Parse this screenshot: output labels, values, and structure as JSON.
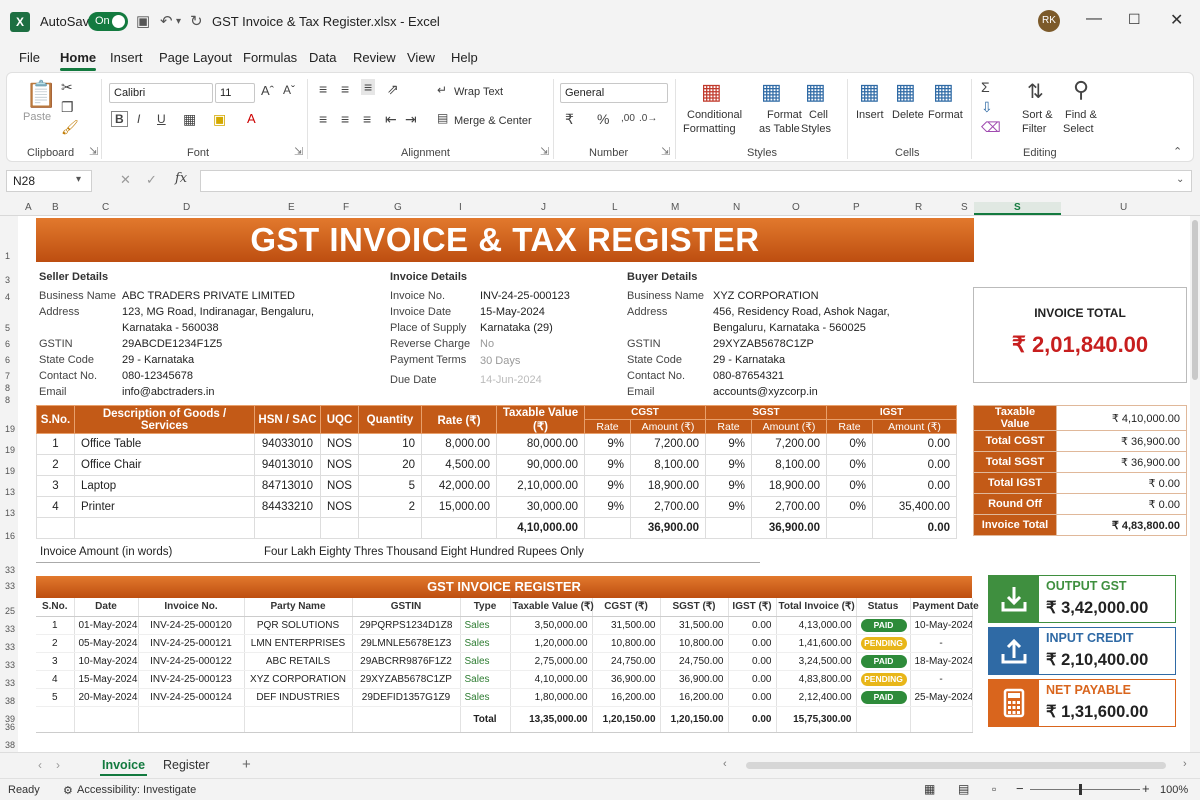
{
  "app": {
    "autosave_label": "AutoSave",
    "autosave_state": "On",
    "title": "GST Invoice & Tax Register.xlsx  -  Excel",
    "user_initials": "RK"
  },
  "menu": [
    "File",
    "Home",
    "Insert",
    "Page Layout",
    "Formulas",
    "Data",
    "Review",
    "View",
    "Help"
  ],
  "ribbon": {
    "paste": "Paste",
    "clipboard": "Clipboard",
    "font_name": "Calibri",
    "font_size": "11",
    "font": "Font",
    "wrap_text": "Wrap Text",
    "merge_center": "Merge & Center",
    "alignment": "Alignment",
    "number_format": "General",
    "number": "Number",
    "conditional_formatting": [
      "Conditional",
      "Formatting"
    ],
    "format_as_table": [
      "Format",
      "as Table"
    ],
    "cell_styles": [
      "Cell",
      "Styles"
    ],
    "styles": "Styles",
    "insert": "Insert",
    "delete": "Delete",
    "format": "Format",
    "cells": "Cells",
    "sort_filter": [
      "Sort &",
      "Filter"
    ],
    "find_select": [
      "Find &",
      "Select"
    ],
    "editing": "Editing"
  },
  "formula_bar": {
    "name_box": "N28",
    "formula": ""
  },
  "columns": [
    "A",
    "B",
    "C",
    "D",
    "E",
    "F",
    "G",
    "I",
    "J",
    "L",
    "M",
    "N",
    "O",
    "P",
    "R",
    "S",
    "S",
    "U"
  ],
  "rows": [
    "1",
    "3",
    "4",
    "5",
    "6",
    "6",
    "7",
    "8",
    "9",
    "8",
    "19",
    "19",
    "19",
    "13",
    "13",
    "16",
    "33",
    "33",
    "25",
    "33",
    "33",
    "33",
    "33",
    "38",
    "38",
    "39",
    "36",
    "38"
  ],
  "sheet_title": "GST INVOICE & TAX REGISTER",
  "seller": {
    "heading": "Seller Details",
    "fields": [
      {
        "label": "Business Name",
        "value": "ABC TRADERS PRIVATE LIMITED"
      },
      {
        "label": "Address",
        "value": "123, MG Road, Indiranagar, Bengaluru,"
      },
      {
        "label": "",
        "value": "Karnataka - 560038"
      },
      {
        "label": "GSTIN",
        "value": "29ABCDE1234F1Z5"
      },
      {
        "label": "State Code",
        "value": "29 - Karnataka"
      },
      {
        "label": "Contact No.",
        "value": "080-12345678"
      },
      {
        "label": "Email",
        "value": "info@abctraders.in"
      }
    ]
  },
  "invoice": {
    "heading": "Invoice Details",
    "fields": [
      {
        "label": "Invoice No.",
        "value": "INV-24-25-000123"
      },
      {
        "label": "Invoice Date",
        "value": "15-May-2024"
      },
      {
        "label": "Place of Supply",
        "value": "Karnataka (29)"
      },
      {
        "label": "Reverse Charge",
        "value": "No"
      },
      {
        "label": "Payment Terms",
        "value": "30 Days"
      },
      {
        "label": "Due Date",
        "value": "14-Jun-2024"
      }
    ]
  },
  "buyer": {
    "heading": "Buyer Details",
    "fields": [
      {
        "label": "Business Name",
        "value": "XYZ CORPORATION"
      },
      {
        "label": "Address",
        "value": "456, Residency Road, Ashok Nagar,"
      },
      {
        "label": "",
        "value": "Bengaluru, Karnataka - 560025"
      },
      {
        "label": "GSTIN",
        "value": "29XYZAB5678C1ZP"
      },
      {
        "label": "State Code",
        "value": "29 - Karnataka"
      },
      {
        "label": "Contact No.",
        "value": "080-87654321"
      },
      {
        "label": "Email",
        "value": "accounts@xyzcorp.in"
      }
    ]
  },
  "invoice_total": {
    "label": "INVOICE TOTAL",
    "value": "₹ 2,01,840.00"
  },
  "items_table": {
    "headers": [
      "S.No.",
      "Description of Goods / Services",
      "HSN / SAC",
      "UQC",
      "Quantity",
      "Rate (₹)",
      "Taxable Value (₹)",
      "CGST",
      "SGST",
      "IGST"
    ],
    "sub_headers": [
      "Rate",
      "Amount (₹)",
      "Rate",
      "Amount (₹)",
      "Rate",
      "Amount (₹)"
    ],
    "rows": [
      [
        "1",
        "Office Table",
        "94033010",
        "NOS",
        "10",
        "8,000.00",
        "80,000.00",
        "9%",
        "7,200.00",
        "9%",
        "7,200.00",
        "0%",
        "0.00"
      ],
      [
        "2",
        "Office Chair",
        "94013010",
        "NOS",
        "20",
        "4,500.00",
        "90,000.00",
        "9%",
        "8,100.00",
        "9%",
        "8,100.00",
        "0%",
        "0.00"
      ],
      [
        "3",
        "Laptop",
        "84713010",
        "NOS",
        "5",
        "42,000.00",
        "2,10,000.00",
        "9%",
        "18,900.00",
        "9%",
        "18,900.00",
        "0%",
        "0.00"
      ],
      [
        "4",
        "Printer",
        "84433210",
        "NOS",
        "2",
        "15,000.00",
        "30,000.00",
        "9%",
        "2,700.00",
        "9%",
        "2,700.00",
        "0%",
        "35,400.00"
      ]
    ],
    "totals": {
      "taxable": "4,10,000.00",
      "cgst": "36,900.00",
      "sgst": "36,900.00",
      "igst": "0.00"
    },
    "words_label": "Invoice Amount (in words)",
    "words_value": "Four Lakh Eighty Thres Thousand Eight Hundred Rupees Only"
  },
  "summary": [
    {
      "label": "Taxable Value",
      "value": "₹ 4,10,000.00"
    },
    {
      "label": "Total CGST",
      "value": "₹ 36,900.00"
    },
    {
      "label": "Total SGST",
      "value": "₹ 36,900.00"
    },
    {
      "label": "Total IGST",
      "value": "₹ 0.00"
    },
    {
      "label": "Round Off",
      "value": "₹ 0.00"
    },
    {
      "label": "Invoice Total",
      "value": "₹ 4,83,800.00"
    }
  ],
  "register": {
    "title": "GST INVOICE REGISTER",
    "headers": [
      "S.No.",
      "Date",
      "Invoice No.",
      "Party Name",
      "GSTIN",
      "Type",
      "Taxable Value (₹)",
      "CGST (₹)",
      "SGST (₹)",
      "IGST (₹)",
      "Total Invoice (₹)",
      "Status",
      "Payment Date"
    ],
    "rows": [
      [
        "1",
        "01-May-2024",
        "INV-24-25-000120",
        "PQR SOLUTIONS",
        "29PQRPS1234D1Z8",
        "Sales",
        "3,50,000.00",
        "31,500.00",
        "31,500.00",
        "0.00",
        "4,13,000.00",
        "PAID",
        "10-May-2024"
      ],
      [
        "2",
        "05-May-2024",
        "INV-24-25-000121",
        "LMN ENTERPRISES",
        "29LMNLE5678E1Z3",
        "Sales",
        "1,20,000.00",
        "10,800.00",
        "10,800.00",
        "0.00",
        "1,41,600.00",
        "PENDING",
        "-"
      ],
      [
        "3",
        "10-May-2024",
        "INV-24-25-000122",
        "ABC RETAILS",
        "29ABCRR9876F1Z2",
        "Sales",
        "2,75,000.00",
        "24,750.00",
        "24,750.00",
        "0.00",
        "3,24,500.00",
        "PAID",
        "18-May-2024"
      ],
      [
        "4",
        "15-May-2024",
        "INV-24-25-000123",
        "XYZ CORPORATION",
        "29XYZAB5678C1ZP",
        "Sales",
        "4,10,000.00",
        "36,900.00",
        "36,900.00",
        "0.00",
        "4,83,800.00",
        "PENDING",
        "-"
      ],
      [
        "5",
        "20-May-2024",
        "INV-24-25-000124",
        "DEF INDUSTRIES",
        "29DEFID1357G1Z9",
        "Sales",
        "1,80,000.00",
        "16,200.00",
        "16,200.00",
        "0.00",
        "2,12,400.00",
        "PAID",
        "25-May-2024"
      ]
    ],
    "total_label": "Total",
    "totals": [
      "13,35,000.00",
      "1,20,150.00",
      "1,20,150.00",
      "0.00",
      "15,75,300.00"
    ]
  },
  "cards": [
    {
      "title": "OUTPUT GST",
      "value": "₹ 3,42,000.00",
      "color": "#3f8f3f",
      "icon": "download-tray-icon"
    },
    {
      "title": "INPUT CREDIT",
      "value": "₹ 2,10,400.00",
      "color": "#2f6aa5",
      "icon": "upload-tray-icon"
    },
    {
      "title": "NET PAYABLE",
      "value": "₹ 1,31,600.00",
      "color": "#d9651d",
      "icon": "calculator-icon"
    }
  ],
  "tabs": [
    "Invoice",
    "Register"
  ],
  "status": {
    "ready": "Ready",
    "accessibility": "Accessibility: Investigate",
    "zoom": "100%"
  }
}
